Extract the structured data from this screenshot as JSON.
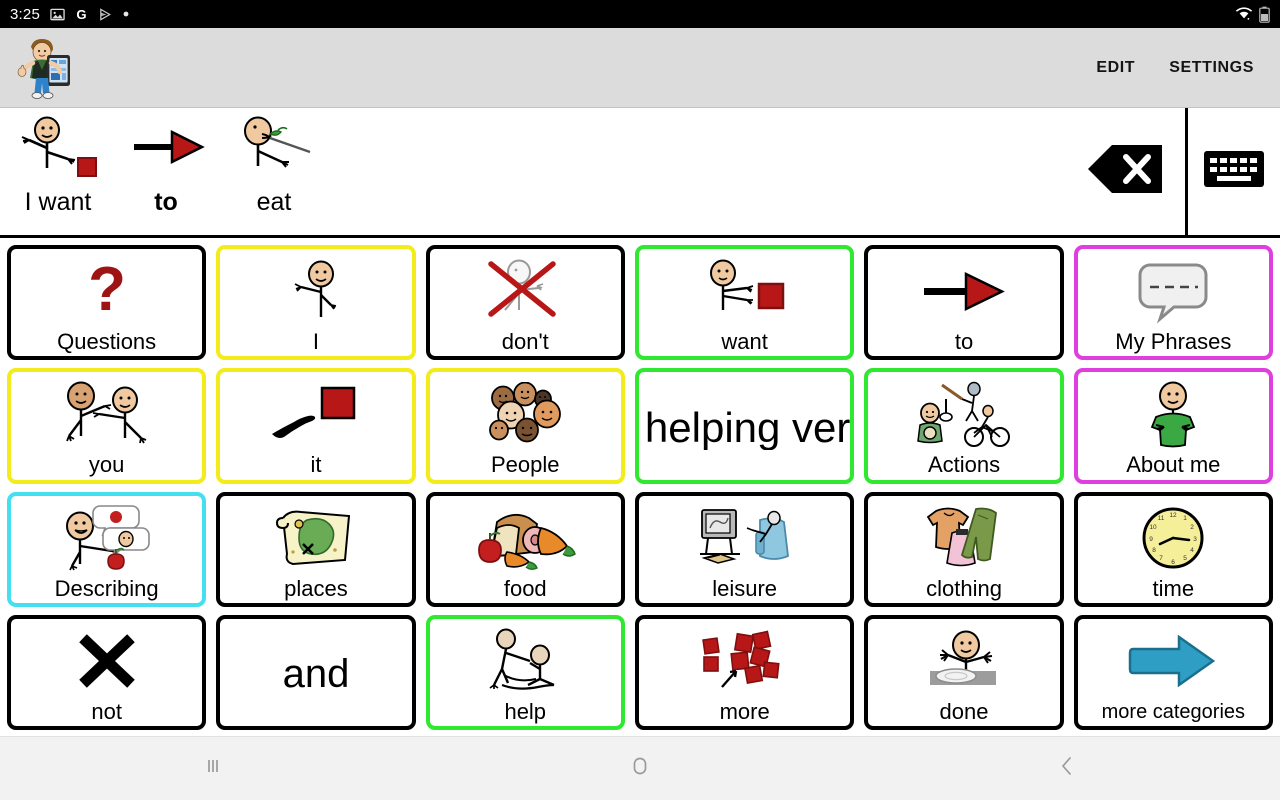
{
  "statusbar": {
    "time": "3:25",
    "left_icons": [
      "image-icon",
      "google-icon",
      "play-store-icon",
      "dot-icon"
    ],
    "right_icons": [
      "wifi-icon",
      "battery-icon"
    ]
  },
  "appbar": {
    "logo_name": "boy-with-tablet-logo",
    "edit_label": "EDIT",
    "settings_label": "SETTINGS"
  },
  "sentence_bar": {
    "words": [
      {
        "label": "I want",
        "symbol": "person-pointing-red-block",
        "bold": false
      },
      {
        "label": "to",
        "symbol": "red-arrow-right",
        "bold": true
      },
      {
        "label": "eat",
        "symbol": "person-eating-fork",
        "bold": false
      }
    ],
    "delete_icon": "backspace-delete-icon",
    "keyboard_icon": "keyboard-icon"
  },
  "grid": {
    "rows": 4,
    "columns": 6,
    "buttons": [
      {
        "label": "Questions",
        "symbol": "question-mark",
        "border": "#000000"
      },
      {
        "label": "I",
        "symbol": "person-pointing-self",
        "border": "#f2ec1a"
      },
      {
        "label": "don't",
        "symbol": "person-crossed-out",
        "border": "#000000"
      },
      {
        "label": "want",
        "symbol": "person-reaching-block",
        "border": "#2fe82f"
      },
      {
        "label": "to",
        "symbol": "red-arrow-right",
        "border": "#000000"
      },
      {
        "label": "My Phrases",
        "symbol": "speech-bubble-dashed",
        "border": "#e03fe0"
      },
      {
        "label": "you",
        "symbol": "two-people-pointing",
        "border": "#f2ec1a"
      },
      {
        "label": "it",
        "symbol": "hand-pointing-red-block",
        "border": "#f2ec1a"
      },
      {
        "label": "People",
        "symbol": "group-of-faces",
        "border": "#f2ec1a"
      },
      {
        "label": "helping ver",
        "symbol": "none",
        "border": "#2fe82f",
        "text_only": true,
        "clipped": true
      },
      {
        "label": "Actions",
        "symbol": "people-doing-activities",
        "border": "#2fe82f"
      },
      {
        "label": "About me",
        "symbol": "person-green-shirt",
        "border": "#e03fe0"
      },
      {
        "label": "Describing",
        "symbol": "person-describing-apple",
        "border": "#45dff2"
      },
      {
        "label": "places",
        "symbol": "treasure-map",
        "border": "#000000"
      },
      {
        "label": "food",
        "symbol": "bread-apple-carrot",
        "border": "#000000"
      },
      {
        "label": "leisure",
        "symbol": "tv-and-armchair",
        "border": "#000000"
      },
      {
        "label": "clothing",
        "symbol": "shirt-and-trousers",
        "border": "#000000"
      },
      {
        "label": "time",
        "symbol": "yellow-clock",
        "border": "#000000"
      },
      {
        "label": "not",
        "symbol": "black-x-mark",
        "border": "#000000"
      },
      {
        "label": "and",
        "symbol": "none",
        "border": "#000000",
        "text_only": true
      },
      {
        "label": "help",
        "symbol": "person-helping-person",
        "border": "#2fe82f"
      },
      {
        "label": "more",
        "symbol": "red-blocks-pile-arrow",
        "border": "#000000"
      },
      {
        "label": "done",
        "symbol": "person-hands-up-plate",
        "border": "#000000"
      },
      {
        "label": "more categories",
        "symbol": "blue-arrow-right",
        "border": "#000000",
        "small_caption": true
      }
    ]
  },
  "navbar": {
    "recents_icon": "recents-icon",
    "home_icon": "home-icon",
    "back_icon": "back-icon"
  },
  "colors": {
    "status_bg": "#000000",
    "appbar_bg": "#dcdcdc",
    "navbar_bg": "#f2f2f2",
    "yellow": "#f2ec1a",
    "green": "#2fe82f",
    "magenta": "#e03fe0",
    "cyan": "#45dff2",
    "symbol_red": "#b81717",
    "skin": "#f0c9a0"
  }
}
